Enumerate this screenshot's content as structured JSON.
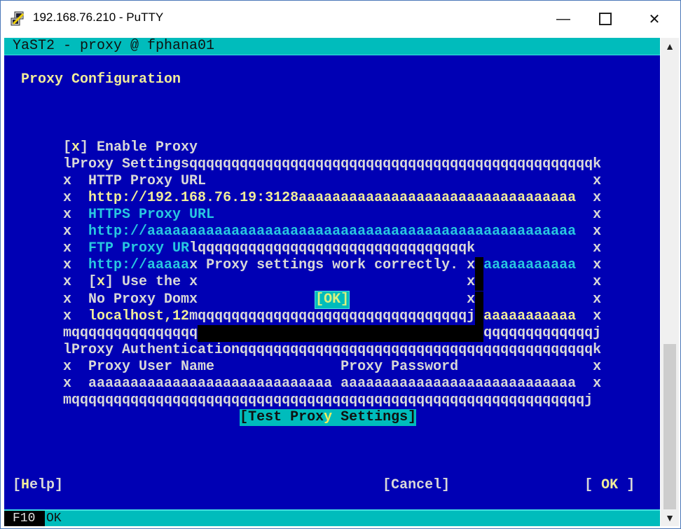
{
  "window": {
    "title": "192.168.76.210 - PuTTY",
    "minimize_icon": "minimize-icon",
    "maximize_icon": "maximize-icon",
    "close_icon": "close-icon"
  },
  "colors": {
    "terminal_bg": "#0000b4",
    "cyan": "#00bcbc",
    "text": "#d8d8d8",
    "highlight": "#f0ec9a"
  },
  "terminal": {
    "header": "YaST2 - proxy @ fphana01",
    "rows": [
      {
        "r": 2,
        "segs": [
          [
            "  ",
            "w"
          ],
          [
            "Proxy Configuration",
            "y"
          ]
        ]
      },
      {
        "r": 6,
        "segs": [
          [
            "       [",
            "w"
          ],
          [
            "x",
            "y"
          ],
          [
            "] Enable Proxy",
            "w"
          ]
        ]
      },
      {
        "r": 7,
        "segs": [
          [
            "       lProxy Settingsqqqqqqqqqqqqqqqqqqqqqqqqqqqqqqqqqqqqqqqqqqqqqqqqk",
            "w"
          ]
        ]
      },
      {
        "r": 8,
        "segs": [
          [
            "       x  HTTP Proxy URL                                              x",
            "w"
          ]
        ]
      },
      {
        "r": 9,
        "segs": [
          [
            "       x  ",
            "w"
          ],
          [
            "http://192.168.76.19:3128aaaaaaaaaaaaaaaaaaaaaaaaaaaaaaaaa",
            "y"
          ],
          [
            "  x",
            "w"
          ]
        ]
      },
      {
        "r": 10,
        "segs": [
          [
            "       x  ",
            "w"
          ],
          [
            "HTTPS Proxy URL",
            "c"
          ],
          [
            "                                             x",
            "w"
          ]
        ]
      },
      {
        "r": 11,
        "segs": [
          [
            "       x  ",
            "w"
          ],
          [
            "http://aaaaaaaaaaaaaaaaaaaaaaaaaaaaaaaaaaaaaaaaaaaaaaaaaaa",
            "c"
          ],
          [
            "  x",
            "w"
          ]
        ]
      },
      {
        "r": 12,
        "segs": [
          [
            "       x  ",
            "w"
          ],
          [
            "FTP Proxy UR",
            "c"
          ],
          [
            "lqqqqqqqqqqqqqqqqqqqqqqqqqqqqqqqqk              x",
            "w"
          ]
        ]
      },
      {
        "r": 13,
        "segs": [
          [
            "       x  ",
            "w"
          ],
          [
            "http://aaaaa",
            "c"
          ],
          [
            "x Proxy settings work correctly. x",
            "w"
          ],
          [
            " ",
            "s"
          ],
          [
            "aaaaaaaaaaa",
            "c"
          ],
          [
            "  x",
            "w"
          ]
        ]
      },
      {
        "r": 14,
        "segs": [
          [
            "       x  [",
            "w"
          ],
          [
            "x",
            "y"
          ],
          [
            "] Use the x                                x",
            "w"
          ],
          [
            " ",
            "s"
          ],
          [
            "             x",
            "w"
          ]
        ]
      },
      {
        "r": 15,
        "segs": [
          [
            "       x  No Proxy Domx              ",
            "w"
          ],
          [
            "[OK]",
            "ok"
          ],
          [
            "              x",
            "w"
          ],
          [
            " ",
            "s"
          ],
          [
            "             x",
            "w"
          ]
        ]
      },
      {
        "r": 16,
        "segs": [
          [
            "       x  ",
            "w"
          ],
          [
            "localhost,12",
            "y"
          ],
          [
            "mqqqqqqqqqqqqqqqqqqqqqqqqqqqqqqqqj",
            "w"
          ],
          [
            " ",
            "s"
          ],
          [
            "aaaaaaaaaaa",
            "y"
          ],
          [
            "  x",
            "w"
          ]
        ]
      },
      {
        "r": 17,
        "segs": [
          [
            "       mqqqqqqqqqqqqqqq",
            "w"
          ],
          [
            "                                  ",
            "s"
          ],
          [
            "qqqqqqqqqqqqqj",
            "w"
          ]
        ]
      },
      {
        "r": 18,
        "segs": [
          [
            "       lProxy Authenticationqqqqqqqqqqqqqqqqqqqqqqqqqqqqqqqqqqqqqqqqqqk",
            "w"
          ]
        ]
      },
      {
        "r": 19,
        "segs": [
          [
            "       x  Proxy User Name               Proxy Password                x",
            "w"
          ]
        ]
      },
      {
        "r": 20,
        "segs": [
          [
            "       x  aaaaaaaaaaaaaaaaaaaaaaaaaaaaa aaaaaaaaaaaaaaaaaaaaaaaaaaaa  x",
            "w"
          ]
        ]
      },
      {
        "r": 21,
        "segs": [
          [
            "       mqqqqqqqqqqqqqqqqqqqqqqqqqqqqqqqqqqqqqqqqqqqqqqqqqqqqqqqqqqqqqj",
            "w"
          ]
        ]
      },
      {
        "r": 22,
        "segs": [
          [
            "                            ",
            "w"
          ],
          [
            "[Test Prox",
            "k"
          ],
          [
            "y",
            "ky"
          ],
          [
            " Settings]",
            "k"
          ]
        ]
      },
      {
        "r": 26,
        "segs": [
          [
            " [",
            "w"
          ],
          [
            "H",
            "y"
          ],
          [
            "elp]                                      [Cancel]                [ ",
            "w"
          ],
          [
            "OK",
            "y"
          ],
          [
            " ]",
            "w"
          ]
        ]
      }
    ],
    "status": {
      "key": "F10",
      "label": "OK"
    }
  }
}
